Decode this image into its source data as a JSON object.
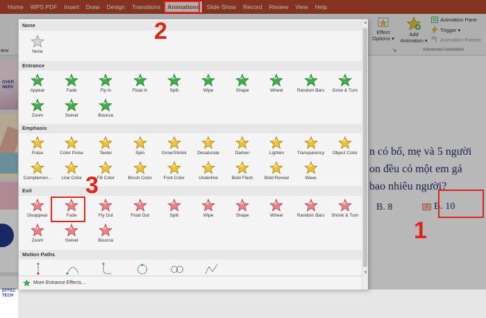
{
  "menubar": {
    "items": [
      {
        "label": "Home"
      },
      {
        "label": "WPS PDF"
      },
      {
        "label": "Insert"
      },
      {
        "label": "Draw"
      },
      {
        "label": "Design"
      },
      {
        "label": "Transitions"
      },
      {
        "label": "Animations",
        "active": true
      },
      {
        "label": "Slide Show"
      },
      {
        "label": "Record"
      },
      {
        "label": "Review"
      },
      {
        "label": "View"
      },
      {
        "label": "Help"
      }
    ]
  },
  "ribbon": {
    "effect_options": {
      "line1": "Effect",
      "line2": "Options ▾"
    },
    "add_animation": {
      "line1": "Add",
      "line2": "Animation ▾"
    },
    "animation_pane": "Animation Pane",
    "trigger": "Trigger ▾",
    "animation_painter": "Animation Painter",
    "group_label": "Advanced Animation",
    "left_stub": "iew"
  },
  "gallery": {
    "sections": [
      {
        "title": "None",
        "effects": [
          {
            "label": "None",
            "icon": "none-star-icon"
          }
        ]
      },
      {
        "title": "Entrance",
        "effects": [
          {
            "label": "Appear"
          },
          {
            "label": "Fade"
          },
          {
            "label": "Fly In"
          },
          {
            "label": "Float In"
          },
          {
            "label": "Split"
          },
          {
            "label": "Wipe"
          },
          {
            "label": "Shape"
          },
          {
            "label": "Wheel"
          },
          {
            "label": "Random Bars"
          },
          {
            "label": "Grow & Turn"
          },
          {
            "label": "Zoom"
          },
          {
            "label": "Swivel"
          },
          {
            "label": "Bounce"
          }
        ]
      },
      {
        "title": "Emphasis",
        "effects": [
          {
            "label": "Pulse"
          },
          {
            "label": "Color Pulse"
          },
          {
            "label": "Teeter"
          },
          {
            "label": "Spin"
          },
          {
            "label": "Grow/Shrink"
          },
          {
            "label": "Desaturate"
          },
          {
            "label": "Darken"
          },
          {
            "label": "Lighten"
          },
          {
            "label": "Transparency"
          },
          {
            "label": "Object Color"
          },
          {
            "label": "Complemen..."
          },
          {
            "label": "Line Color"
          },
          {
            "label": "Fill Color"
          },
          {
            "label": "Brush Color"
          },
          {
            "label": "Font Color"
          },
          {
            "label": "Underline"
          },
          {
            "label": "Bold Flash"
          },
          {
            "label": "Bold Reveal"
          },
          {
            "label": "Wave"
          }
        ]
      },
      {
        "title": "Exit",
        "effects": [
          {
            "label": "Disappear"
          },
          {
            "label": "Fade"
          },
          {
            "label": "Fly Out"
          },
          {
            "label": "Float Out"
          },
          {
            "label": "Split"
          },
          {
            "label": "Wipe"
          },
          {
            "label": "Shape"
          },
          {
            "label": "Wheel"
          },
          {
            "label": "Random Bars"
          },
          {
            "label": "Shrink & Turn"
          },
          {
            "label": "Zoom"
          },
          {
            "label": "Swivel"
          },
          {
            "label": "Bounce"
          }
        ]
      },
      {
        "title": "Motion Paths",
        "effects": []
      }
    ],
    "footer_label": "More Entrance Effects..."
  },
  "colors": {
    "entrance_green": "#3fae49",
    "exit_red": "#e8838a",
    "emphasis_gold": "#f2c232",
    "accent_red": "#e0221b",
    "brand": "#b7472a"
  },
  "slide": {
    "line1": "n có bố, mẹ và 5 người",
    "line2": "on đều có một em gá",
    "line3": "bao nhiêu người?",
    "answer_b8": "B. 8",
    "answer_b10": "B. 10",
    "anim_tag": "2"
  },
  "thumbnail_text": {
    "t1": "OVER",
    "t2": "NERV",
    "t3": "EFFEC",
    "t4": "TECH"
  },
  "annotations": {
    "step1": "1",
    "step2": "2",
    "step3": "3"
  }
}
